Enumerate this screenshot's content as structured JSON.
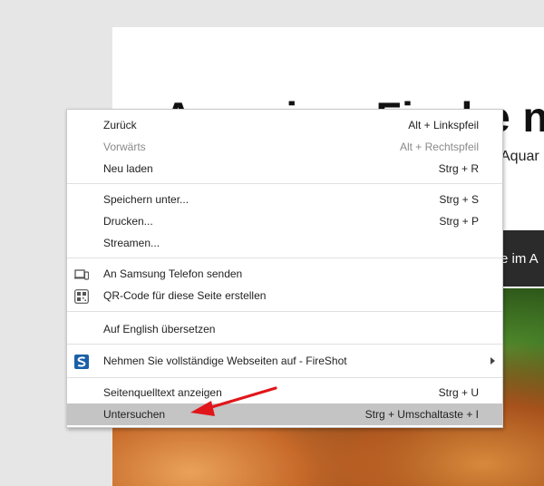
{
  "page": {
    "title": "Aquarium-Fische ne",
    "subtitle": "Aquar",
    "nav_text": "e im A"
  },
  "context_menu": {
    "groups": [
      {
        "items": [
          {
            "label": "Zurück",
            "shortcut": "Alt + Linkspfeil",
            "disabled": false
          },
          {
            "label": "Vorwärts",
            "shortcut": "Alt + Rechtspfeil",
            "disabled": true
          },
          {
            "label": "Neu laden",
            "shortcut": "Strg + R",
            "disabled": false
          }
        ]
      },
      {
        "items": [
          {
            "label": "Speichern unter...",
            "shortcut": "Strg + S",
            "disabled": false
          },
          {
            "label": "Drucken...",
            "shortcut": "Strg + P",
            "disabled": false
          },
          {
            "label": "Streamen...",
            "shortcut": "",
            "disabled": false
          }
        ]
      },
      {
        "items": [
          {
            "label": "An Samsung Telefon senden",
            "shortcut": "",
            "icon": "send-to-device-icon"
          },
          {
            "label": "QR-Code für diese Seite erstellen",
            "shortcut": "",
            "icon": "qr-code-icon"
          }
        ]
      },
      {
        "items": [
          {
            "label": "Auf English übersetzen",
            "shortcut": ""
          }
        ]
      },
      {
        "items": [
          {
            "label": "Nehmen Sie vollständige Webseiten auf - FireShot",
            "shortcut": "",
            "icon": "fireshot-icon",
            "submenu": true
          }
        ]
      },
      {
        "items": [
          {
            "label": "Seitenquelltext anzeigen",
            "shortcut": "Strg + U"
          },
          {
            "label": "Untersuchen",
            "shortcut": "Strg + Umschaltaste + I",
            "highlighted": true
          }
        ]
      }
    ]
  },
  "colors": {
    "highlight": "#c4c4c4",
    "annotation_arrow": "#e0161b",
    "fireshot_brand": "#1a5fa8"
  }
}
